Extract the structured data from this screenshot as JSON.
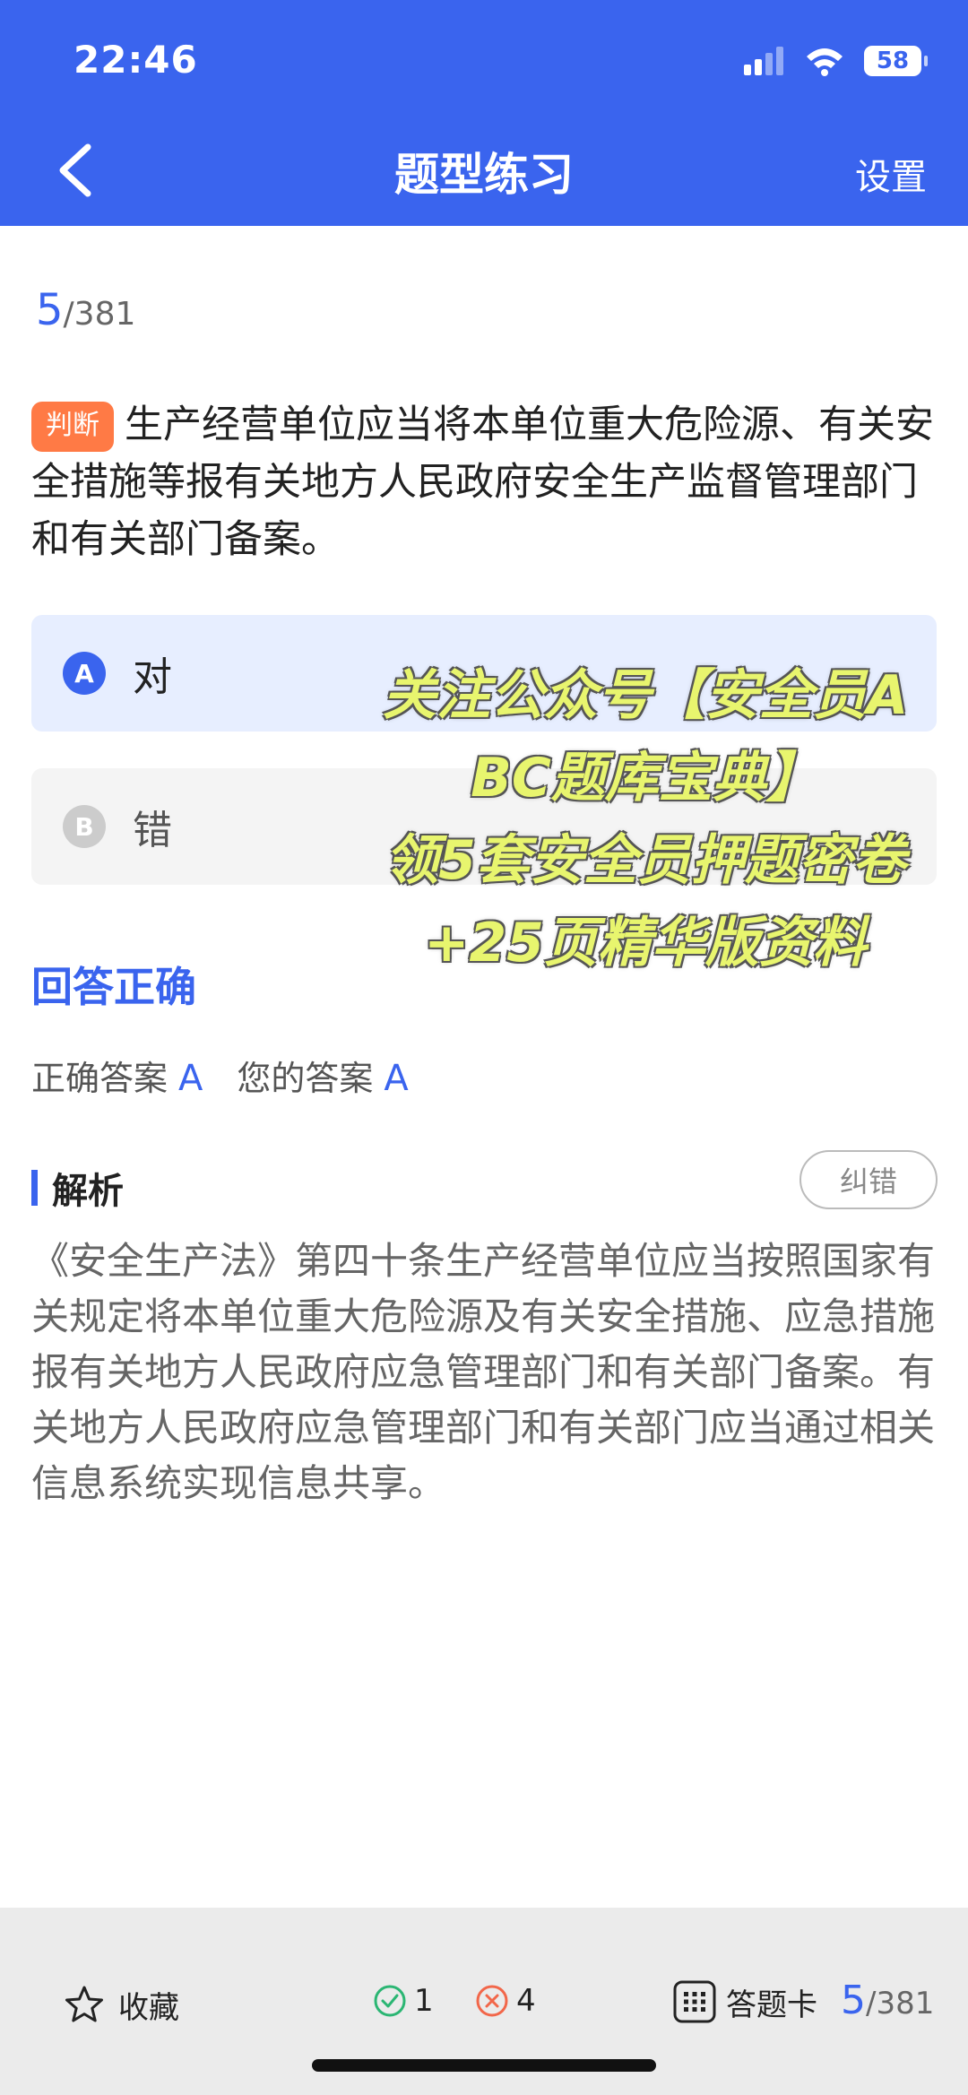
{
  "status_bar": {
    "time": "22:46",
    "battery": "58"
  },
  "nav": {
    "title": "题型练习",
    "settings": "设置"
  },
  "progress": {
    "current": "5",
    "total": "/381"
  },
  "question": {
    "type_badge": "判断",
    "text": "生产经营单位应当将本单位重大危险源、有关安全措施等报有关地方人民政府安全生产监督管理部门和有关部门备案。"
  },
  "options": [
    {
      "letter": "A",
      "text": "对",
      "selected": true
    },
    {
      "letter": "B",
      "text": "错",
      "selected": false
    }
  ],
  "result": {
    "status": "回答正确",
    "correct_label": "正确答案",
    "correct_value": "A",
    "yours_label": "您的答案",
    "yours_value": "A"
  },
  "analysis": {
    "title": "解析",
    "report_button": "纠错",
    "text": "《安全生产法》第四十条生产经营单位应当按照国家有关规定将本单位重大危险源及有关安全措施、应急措施报有关地方人民政府应急管理部门和有关部门备案。有关地方人民政府应急管理部门和有关部门应当通过相关信息系统实现信息共享。"
  },
  "watermark": {
    "lines": [
      "关注公众号【安全员A",
      "BC题库宝典】",
      "领5套安全员押题密卷",
      "+25页精华版资料"
    ]
  },
  "bottom_bar": {
    "favorite": "收藏",
    "correct_count": "1",
    "wrong_count": "4",
    "answer_card": "答题卡",
    "current": "5",
    "total": "/381"
  },
  "colors": {
    "primary": "#3a64ee",
    "badge": "#ff7a45",
    "correct": "#2bb673",
    "wrong": "#f2674a"
  }
}
